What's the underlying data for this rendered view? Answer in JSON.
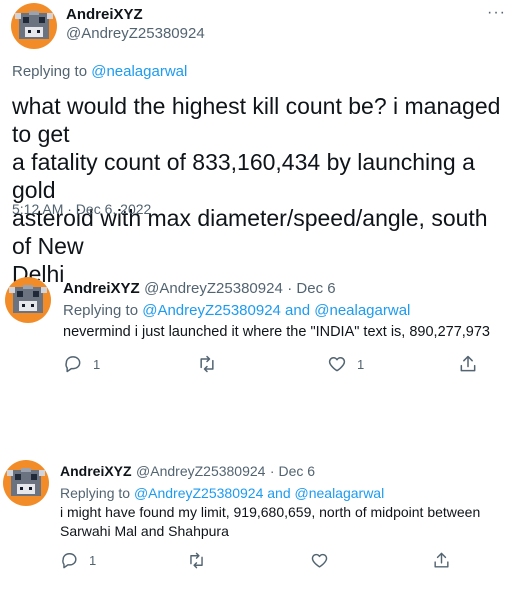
{
  "main_tweet": {
    "author_name": "AndreiXYZ",
    "author_handle": "@AndreyZ25380924",
    "more_label": "···",
    "replying_prefix": "Replying to ",
    "replying_to": "@nealagarwal",
    "text_lines": [
      "what would the highest kill count be? i managed to get",
      "a fatality count of 833,160,434 by launching a gold",
      "asteroid with max diameter/speed/angle, south of New",
      "Delhi"
    ],
    "timestamp": "5:12 AM · Dec 6, 2022"
  },
  "replies": [
    {
      "author_name": "AndreiXYZ",
      "author_handle": "@AndreyZ25380924",
      "date": "· Dec 6",
      "replying_prefix": "Replying to ",
      "replying_to_1": "@AndreyZ25380924",
      "replying_and": " and ",
      "replying_to_2": "@nealagarwal",
      "text_lines": [
        "nevermind i just launched it where the \"INDIA\" text is, 890,277,973"
      ],
      "reply_count": "1",
      "retweet_count": "",
      "like_count": "1"
    },
    {
      "author_name": "AndreiXYZ",
      "author_handle": "@AndreyZ25380924",
      "date": "· Dec 6",
      "replying_prefix": "Replying to ",
      "replying_to_1": "@AndreyZ25380924",
      "replying_and": " and ",
      "replying_to_2": "@nealagarwal",
      "text_lines": [
        "i might have found my limit, 919,680,659, north of midpoint between",
        "Sarwahi Mal and Shahpura"
      ],
      "reply_count": "1",
      "retweet_count": "",
      "like_count": ""
    }
  ],
  "icons": {
    "reply": "reply-bubble-icon",
    "retweet": "retweet-icon",
    "like": "heart-icon",
    "share": "share-icon",
    "more": "more-dots-icon"
  },
  "colors": {
    "link": "#1d9bf0",
    "muted": "#536471",
    "text": "#0f1419",
    "avatar_bg": "#f28c28"
  }
}
